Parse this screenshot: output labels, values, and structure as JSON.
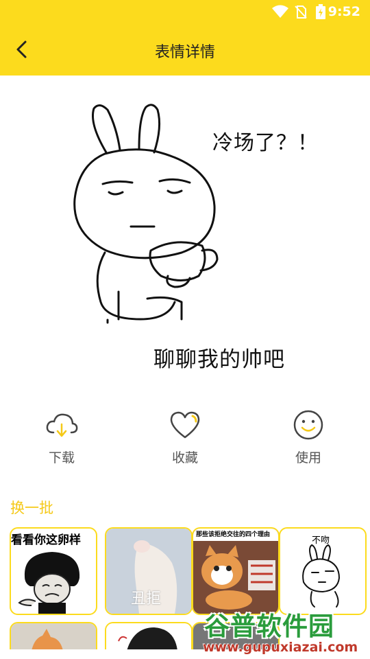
{
  "status_bar": {
    "time": "9:52"
  },
  "header": {
    "title": "表情详情"
  },
  "sticker": {
    "caption_top": "冷场了？！",
    "caption_bottom": "聊聊我的帅吧"
  },
  "actions": [
    {
      "label": "下载",
      "icon": "cloud-download-icon"
    },
    {
      "label": "收藏",
      "icon": "heart-icon"
    },
    {
      "label": "使用",
      "icon": "smiley-icon"
    }
  ],
  "refresh_label": "换一批",
  "thumbnails": [
    {
      "text": "看看你这卵样"
    },
    {
      "text": "丑拒"
    },
    {
      "text": "那些该拒绝交往的四个理由"
    },
    {
      "text": "不吻"
    }
  ],
  "watermark": {
    "brand": "谷普软件园",
    "url": "www.gupuxiazai.com"
  },
  "colors": {
    "accent": "#fcdb1d",
    "refresh_text": "#f5c918"
  }
}
